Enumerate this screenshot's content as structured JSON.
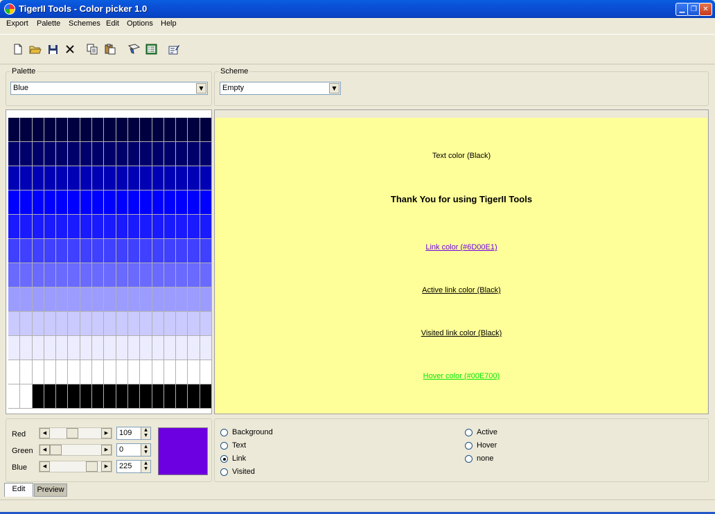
{
  "window": {
    "title": "TigerII Tools - Color picker 1.0"
  },
  "menu": [
    "Export",
    "Palette",
    "Schemes",
    "Edit",
    "Options",
    "Help"
  ],
  "toolbar": {
    "buttons": [
      "new-file-icon",
      "open-folder-icon",
      "save-icon",
      "delete-icon",
      "copy-icon",
      "paste-icon",
      "palette-tool-icon",
      "list-icon",
      "edit-properties-icon"
    ]
  },
  "palette_group": {
    "label": "Palette",
    "value": "Blue"
  },
  "scheme_group": {
    "label": "Scheme",
    "value": "Empty"
  },
  "swatch_rows": [
    "#000040",
    "#00006b",
    "#0000b4",
    "#0000ff",
    "#1a1aff",
    "#4040ff",
    "#6a6aff",
    "#9c9cff",
    "#cacaff",
    "#ececff",
    "#ffffff",
    "#000000"
  ],
  "preview": {
    "background": "#ffff99",
    "text_color": "Text color (Black)",
    "heading": "Thank You for using TigerII Tools",
    "link": "Link color (#6D00E1)",
    "link_color": "#6d00e1",
    "active_link": "Active link color (Black)",
    "visited_link": "Visited link color (Black)",
    "hover": "Hover color (#00E700)",
    "hover_color": "#00e700"
  },
  "rgb": {
    "red": {
      "label": "Red",
      "value": "109"
    },
    "green": {
      "label": "Green",
      "value": "0"
    },
    "blue": {
      "label": "Blue",
      "value": "225"
    },
    "selected_color": "#6d00e1"
  },
  "targets": {
    "left": [
      {
        "label": "Background",
        "selected": false
      },
      {
        "label": "Text",
        "selected": false
      },
      {
        "label": "Link",
        "selected": true
      },
      {
        "label": "Visited",
        "selected": false
      }
    ],
    "right": [
      {
        "label": "Active",
        "selected": false
      },
      {
        "label": "Hover",
        "selected": false
      },
      {
        "label": "none",
        "selected": false
      }
    ]
  },
  "tabs": [
    "Edit",
    "Preview"
  ]
}
